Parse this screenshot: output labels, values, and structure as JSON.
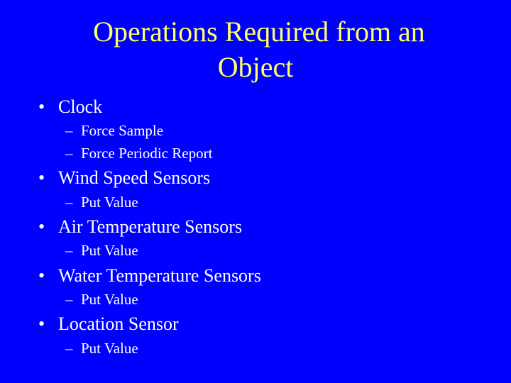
{
  "slide": {
    "title_line1": "Operations Required from an",
    "title_line2": "Object",
    "bullets": [
      {
        "label": "Clock",
        "subs": [
          "Force Sample",
          "Force Periodic Report"
        ]
      },
      {
        "label": "Wind Speed Sensors",
        "subs": [
          "Put Value"
        ]
      },
      {
        "label": "Air Temperature Sensors",
        "subs": [
          "Put Value"
        ]
      },
      {
        "label": "Water Temperature Sensors",
        "subs": [
          "Put Value"
        ]
      },
      {
        "label": "Location Sensor",
        "subs": [
          "Put Value"
        ]
      }
    ],
    "bullet_glyph": "•",
    "sub_glyph": "–",
    "colors": {
      "background": "#0000ff",
      "title": "#ffff66",
      "body": "#ffffff"
    }
  }
}
